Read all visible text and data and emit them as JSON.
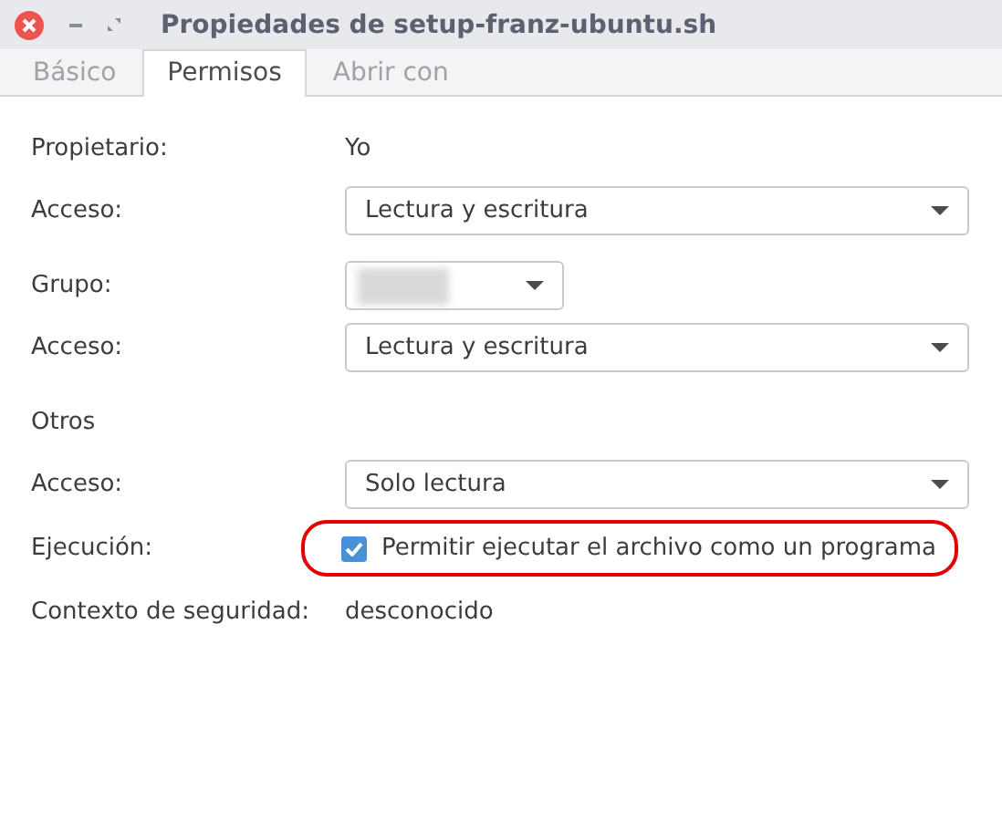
{
  "window": {
    "title": "Propiedades de setup-franz-ubuntu.sh"
  },
  "tabs": [
    {
      "label": "Básico",
      "selected": false
    },
    {
      "label": "Permisos",
      "selected": true
    },
    {
      "label": "Abrir con",
      "selected": false
    }
  ],
  "rows": [
    {
      "kind": "text",
      "label": "Propietario:",
      "value": "Yo"
    },
    {
      "kind": "dropdown",
      "label": "Acceso:",
      "value": "Lectura y escritura"
    },
    {
      "kind": "gap"
    },
    {
      "kind": "dropdown",
      "label": "Grupo:",
      "redacted": true
    },
    {
      "kind": "dropdown",
      "label": "Acceso:",
      "value": "Lectura y escritura"
    },
    {
      "kind": "gap"
    },
    {
      "kind": "heading",
      "label": "Otros"
    },
    {
      "kind": "dropdown",
      "label": "Acceso:",
      "value": "Solo lectura"
    },
    {
      "kind": "checkbox",
      "label": "Ejecución:",
      "value": "Permitir ejecutar el archivo como un programa",
      "checked": true,
      "highlighted": true
    },
    {
      "kind": "text",
      "label": "Contexto de seguridad:",
      "value": "desconocido"
    }
  ]
}
